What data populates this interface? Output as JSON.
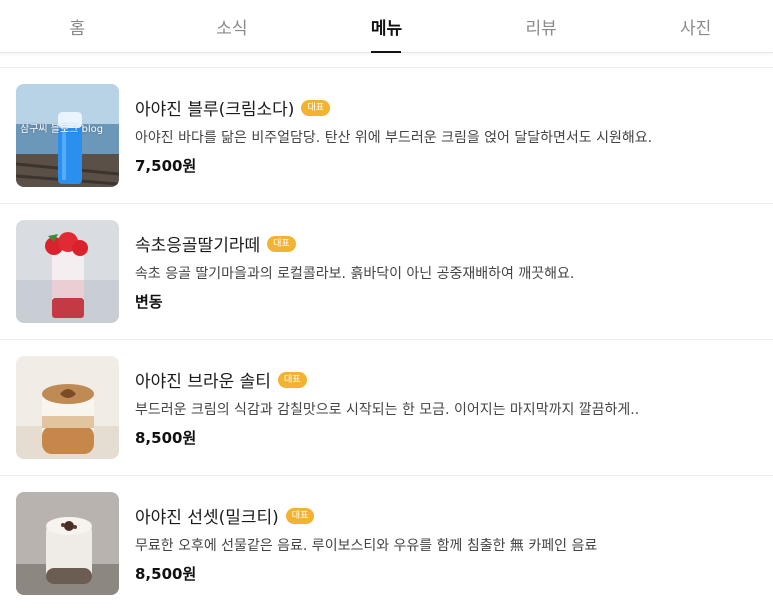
{
  "tabs": [
    {
      "label": "홈",
      "active": false
    },
    {
      "label": "소식",
      "active": false
    },
    {
      "label": "메뉴",
      "active": true
    },
    {
      "label": "리뷰",
      "active": false
    },
    {
      "label": "사진",
      "active": false
    }
  ],
  "menu": [
    {
      "name": "아야진 블루(크림소다)",
      "badge": "대표",
      "description": "아야진 바다를 닮은 비주얼담당. 탄산 위에 부드러운 크림을 얹어 달달하면서도 시원해요.",
      "price": "7,500원",
      "image_watermark": "삼구씨 블로그 blog"
    },
    {
      "name": "속초응골딸기라떼",
      "badge": "대표",
      "description": "속초 응골 딸기마을과의 로컬콜라보. 흙바닥이 아닌 공중재배하여 깨끗해요.",
      "price": "변동"
    },
    {
      "name": "아야진 브라운 솔티",
      "badge": "대표",
      "description": "부드러운 크림의 식감과 감칠맛으로 시작되는 한 모금. 이어지는 마지막까지 깔끔하게..",
      "price": "8,500원"
    },
    {
      "name": "아야진 선셋(밀크티)",
      "badge": "대표",
      "description": "무료한 오후에 선물같은 음료. 루이보스티와 우유를 함께 침출한 無 카페인 음료",
      "price": "8,500원"
    }
  ],
  "colors": {
    "badge": "#f2b331",
    "active_tab": "#111111",
    "inactive_tab": "#8a8a8a"
  }
}
